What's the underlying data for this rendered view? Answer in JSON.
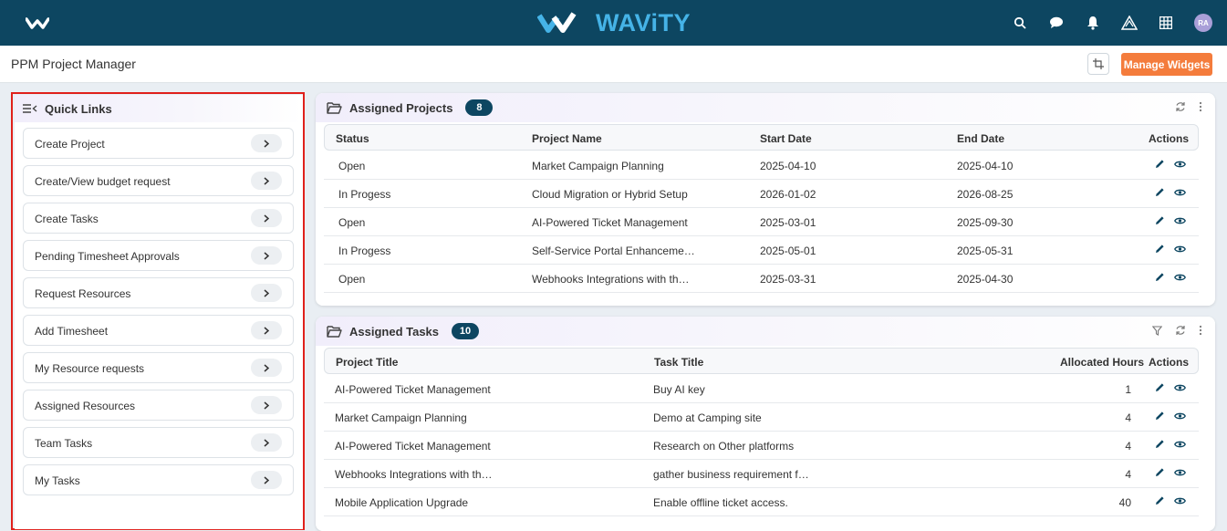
{
  "header": {
    "brand": "WAViTY",
    "avatar_initials": "RA",
    "icons": [
      "search-icon",
      "chat-icon",
      "bell-icon",
      "alert-triangle-icon",
      "grid-icon"
    ]
  },
  "subheader": {
    "page_title": "PPM Project Manager",
    "manage_widgets_label": "Manage Widgets"
  },
  "quick_links": {
    "title": "Quick Links",
    "items": [
      {
        "label": "Create Project"
      },
      {
        "label": "Create/View budget request"
      },
      {
        "label": "Create Tasks"
      },
      {
        "label": "Pending Timesheet Approvals"
      },
      {
        "label": "Request Resources"
      },
      {
        "label": "Add Timesheet"
      },
      {
        "label": "My Resource requests"
      },
      {
        "label": "Assigned Resources"
      },
      {
        "label": "Team Tasks"
      },
      {
        "label": "My Tasks"
      }
    ]
  },
  "assigned_projects": {
    "title": "Assigned Projects",
    "count": "8",
    "columns": [
      "Status",
      "Project Name",
      "Start Date",
      "End Date",
      "Actions"
    ],
    "rows": [
      {
        "status": "Open",
        "name": "Market Campaign Planning",
        "start": "2025-04-10",
        "end": "2025-04-10"
      },
      {
        "status": "In Progess",
        "name": "Cloud Migration or Hybrid Setup",
        "start": "2026-01-02",
        "end": "2026-08-25"
      },
      {
        "status": "Open",
        "name": "AI-Powered Ticket Management",
        "start": "2025-03-01",
        "end": "2025-09-30"
      },
      {
        "status": "In Progess",
        "name": "Self-Service Portal Enhanceme…",
        "start": "2025-05-01",
        "end": "2025-05-31"
      },
      {
        "status": "Open",
        "name": "Webhooks Integrations with th…",
        "start": "2025-03-31",
        "end": "2025-04-30"
      }
    ],
    "status_colors": {
      "Open": "#f4a51c",
      "In Progess": "#2f8fc8"
    }
  },
  "assigned_tasks": {
    "title": "Assigned Tasks",
    "count": "10",
    "columns": [
      "Project Title",
      "Task Title",
      "Allocated Hours",
      "Actions"
    ],
    "rows": [
      {
        "project": "AI-Powered Ticket Management",
        "task": "Buy AI key",
        "hours": "1"
      },
      {
        "project": "Market Campaign Planning",
        "task": "Demo at Camping site",
        "hours": "4"
      },
      {
        "project": "AI-Powered Ticket Management",
        "task": "Research on Other platforms",
        "hours": "4"
      },
      {
        "project": "Webhooks Integrations with th…",
        "task": "gather business requirement f…",
        "hours": "4"
      },
      {
        "project": "Mobile Application Upgrade",
        "task": "Enable offline ticket access.",
        "hours": "40"
      }
    ]
  },
  "colors": {
    "topbar": "#0d4661",
    "brand": "#45b3e7",
    "accent": "#f47c3c",
    "outline": "#e0201b"
  }
}
